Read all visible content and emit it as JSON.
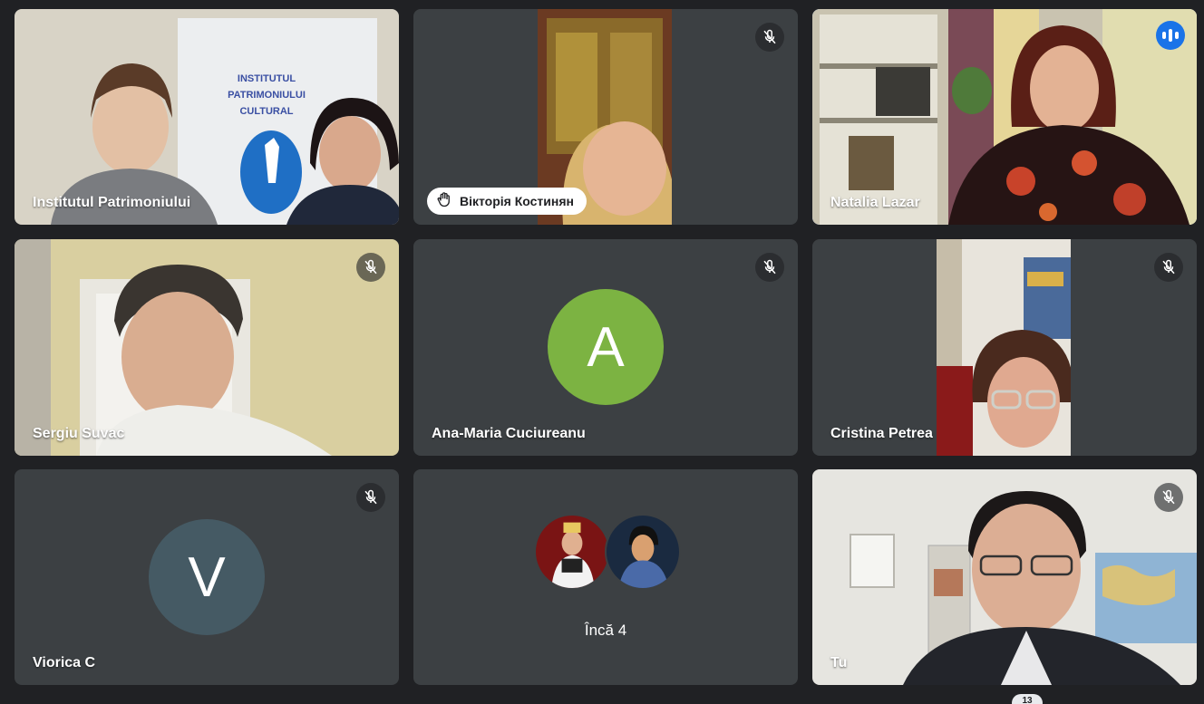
{
  "colors": {
    "background": "#202124",
    "tile": "#3c4043",
    "speaking_outline": "#8ab4f8",
    "speaking_badge": "#1a73e8",
    "avatar_a": "#7cb342",
    "avatar_v": "#455a64"
  },
  "tiles": [
    {
      "name": "Institutul Patrimoniului",
      "banner": [
        "INSTITUTUL",
        "PATRIMONIULUI",
        "CULTURAL"
      ]
    },
    {
      "name": "Вікторія Костинян",
      "hand_raised": true,
      "muted": true
    },
    {
      "name": "Natalia Lazar",
      "speaking": true
    },
    {
      "name": "Sergiu Suvac",
      "muted": true
    },
    {
      "name": "Ana-Maria Cuciureanu",
      "muted": true,
      "avatar_letter": "A"
    },
    {
      "name": "Cristina Petrea",
      "muted": true
    },
    {
      "name": "Viorica C",
      "muted": true,
      "avatar_letter": "V"
    },
    {
      "more_label": "Încă 4"
    },
    {
      "name": "Tu",
      "muted": true
    }
  ],
  "participant_count": "13",
  "icons": [
    "mic-off-icon",
    "hand-raised-icon",
    "audio-level-icon"
  ]
}
